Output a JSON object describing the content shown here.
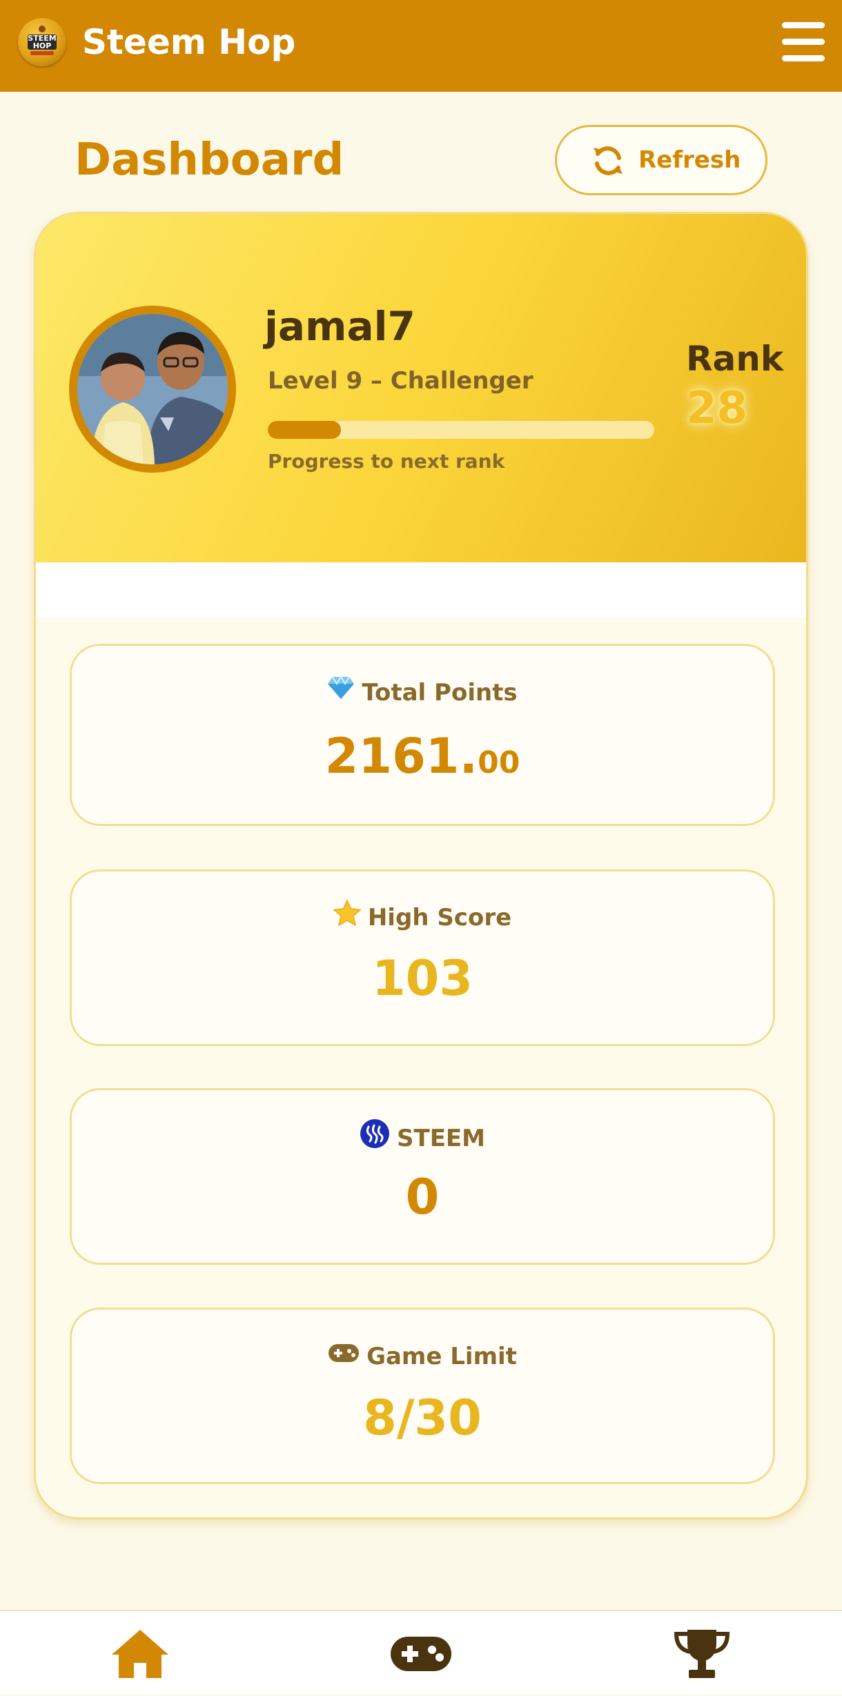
{
  "app": {
    "title": "Steem Hop",
    "logo_text_top": "STEEM",
    "logo_text_bottom": "HOP"
  },
  "header": {
    "menu_icon": "hamburger-menu-icon"
  },
  "page": {
    "title": "Dashboard",
    "refresh_label": "Refresh",
    "refresh_icon": "refresh-icon"
  },
  "profile": {
    "username": "jamal7",
    "level_text": "Level 9 – Challenger",
    "progress_fraction": 0.19,
    "progress_label": "Progress to next rank",
    "rank_label": "Rank",
    "rank_value": "28"
  },
  "stats": [
    {
      "icon": "gem-icon",
      "label": "Total Points",
      "value_main": "2161.",
      "value_small": "00",
      "color": "#d38804"
    },
    {
      "icon": "star-icon",
      "label": "High Score",
      "value_main": "103",
      "value_small": "",
      "color": "#eab61f"
    },
    {
      "icon": "steem-icon",
      "label": "STEEM",
      "value_main": "0",
      "value_small": "",
      "color": "#d38804"
    },
    {
      "icon": "gamepad-icon",
      "label": "Game Limit",
      "value_main": "8/30",
      "value_small": "",
      "color": "#eab61f"
    }
  ],
  "nav": [
    {
      "icon": "home-icon",
      "color": "#d38804"
    },
    {
      "icon": "gamepad-icon",
      "color": "#4a3410"
    },
    {
      "icon": "trophy-icon",
      "color": "#4a3410"
    }
  ],
  "colors": {
    "brand": "#d38804",
    "accent_gold": "#eab61f",
    "dark_brown": "#4a3410",
    "background": "#fdf9e9"
  }
}
